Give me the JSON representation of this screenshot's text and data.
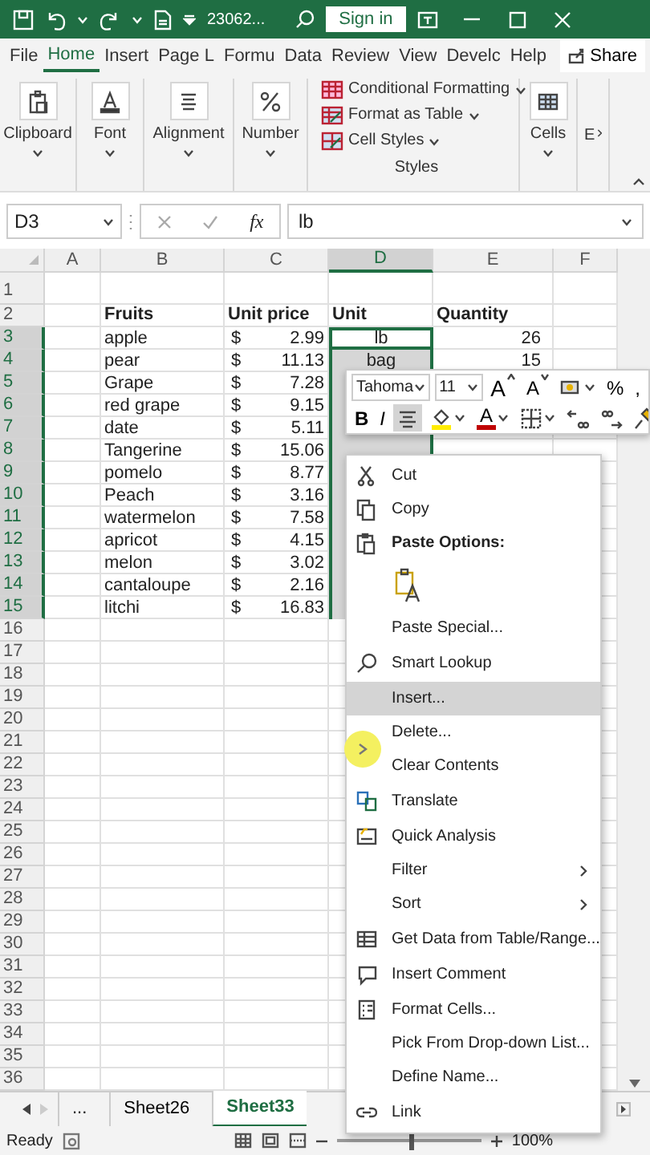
{
  "title_bar": {
    "file_name": "23062...",
    "sign_in": "Sign in"
  },
  "ribbon_tabs": [
    {
      "label": "File",
      "selected": false
    },
    {
      "label": "Home",
      "selected": true
    },
    {
      "label": "Insert",
      "selected": false
    },
    {
      "label": "Page L",
      "selected": false
    },
    {
      "label": "Formu",
      "selected": false
    },
    {
      "label": "Data",
      "selected": false
    },
    {
      "label": "Review",
      "selected": false
    },
    {
      "label": "View",
      "selected": false
    },
    {
      "label": "Develc",
      "selected": false
    },
    {
      "label": "Help",
      "selected": false
    }
  ],
  "share": "Share",
  "ribbon_groups": [
    {
      "kind": "large",
      "label": "Clipboard"
    },
    {
      "kind": "large",
      "label": "Font"
    },
    {
      "kind": "large",
      "label": "Alignment"
    },
    {
      "kind": "large",
      "label": "Number"
    },
    {
      "kind": "styles",
      "label": "Styles",
      "commands": [
        "Conditional Formatting",
        "Format as Table",
        "Cell Styles"
      ]
    },
    {
      "kind": "large",
      "label": "Cells"
    },
    {
      "kind": "cut",
      "label": "E"
    }
  ],
  "formula_bar": {
    "name_box": "D3",
    "fx": "fx",
    "content": "lb"
  },
  "sheet": {
    "columns": [
      {
        "label": "A",
        "selected": false
      },
      {
        "label": "B",
        "selected": false
      },
      {
        "label": "C",
        "selected": false
      },
      {
        "label": "D",
        "selected": true
      },
      {
        "label": "E",
        "selected": false
      },
      {
        "label": "F",
        "selected": false
      }
    ],
    "rows": [
      {
        "header": "1",
        "selected": false
      },
      {
        "header": "2",
        "selected": false,
        "cells": {
          "B": "Fruits",
          "C": "Unit price",
          "D": "Unit",
          "E": "Quantity"
        }
      },
      {
        "header": "3",
        "selected": true,
        "cells": {
          "B": "apple",
          "C": {
            "symbol": "$",
            "amount": "2.99"
          },
          "D": "lb",
          "E": "26"
        }
      },
      {
        "header": "4",
        "selected": true,
        "cells": {
          "B": "pear",
          "C": {
            "symbol": "$",
            "amount": "11.13"
          },
          "D": "bag",
          "E": "15"
        }
      },
      {
        "header": "5",
        "selected": true,
        "cells": {
          "B": "Grape",
          "C": {
            "symbol": "$",
            "amount": "7.28"
          }
        }
      },
      {
        "header": "6",
        "selected": true,
        "cells": {
          "B": "red grape",
          "C": {
            "symbol": "$",
            "amount": "9.15"
          }
        }
      },
      {
        "header": "7",
        "selected": true,
        "cells": {
          "B": "date",
          "C": {
            "symbol": "$",
            "amount": "5.11"
          }
        }
      },
      {
        "header": "8",
        "selected": true,
        "cells": {
          "B": "Tangerine",
          "C": {
            "symbol": "$",
            "amount": "15.06"
          }
        }
      },
      {
        "header": "9",
        "selected": true,
        "cells": {
          "B": "pomelo",
          "C": {
            "symbol": "$",
            "amount": "8.77"
          }
        }
      },
      {
        "header": "10",
        "selected": true,
        "cells": {
          "B": "Peach",
          "C": {
            "symbol": "$",
            "amount": "3.16"
          }
        }
      },
      {
        "header": "11",
        "selected": true,
        "cells": {
          "B": "watermelon",
          "C": {
            "symbol": "$",
            "amount": "7.58"
          }
        }
      },
      {
        "header": "12",
        "selected": true,
        "cells": {
          "B": "apricot",
          "C": {
            "symbol": "$",
            "amount": "4.15"
          }
        }
      },
      {
        "header": "13",
        "selected": true,
        "cells": {
          "B": "melon",
          "C": {
            "symbol": "$",
            "amount": "3.02"
          }
        }
      },
      {
        "header": "14",
        "selected": true,
        "cells": {
          "B": "cantaloupe",
          "C": {
            "symbol": "$",
            "amount": "2.16"
          }
        }
      },
      {
        "header": "15",
        "selected": true,
        "cells": {
          "B": "litchi",
          "C": {
            "symbol": "$",
            "amount": "16.83"
          }
        }
      },
      {
        "header": "16",
        "selected": false
      },
      {
        "header": "17",
        "selected": false
      },
      {
        "header": "18",
        "selected": false
      },
      {
        "header": "19",
        "selected": false
      },
      {
        "header": "20",
        "selected": false
      },
      {
        "header": "21",
        "selected": false
      },
      {
        "header": "22",
        "selected": false
      },
      {
        "header": "23",
        "selected": false
      },
      {
        "header": "24",
        "selected": false
      },
      {
        "header": "25",
        "selected": false
      },
      {
        "header": "26",
        "selected": false
      },
      {
        "header": "27",
        "selected": false
      },
      {
        "header": "28",
        "selected": false
      },
      {
        "header": "29",
        "selected": false
      },
      {
        "header": "30",
        "selected": false
      },
      {
        "header": "31",
        "selected": false
      },
      {
        "header": "32",
        "selected": false
      },
      {
        "header": "33",
        "selected": false
      },
      {
        "header": "34",
        "selected": false
      },
      {
        "header": "35",
        "selected": false
      },
      {
        "header": "36",
        "selected": false
      }
    ]
  },
  "sheet_tabs": {
    "overflow": "...",
    "tabs": [
      {
        "label": "Sheet26",
        "selected": false
      },
      {
        "label": "Sheet33",
        "selected": true
      }
    ]
  },
  "status_bar": {
    "status": "Ready",
    "zoom": "100%",
    "zoom_slider": {
      "level": 0.5
    }
  },
  "mini_toolbar": {
    "font": "Tahoma",
    "size": "11",
    "row1": [
      {
        "kind": "grow",
        "label": "A"
      },
      {
        "kind": "shrink",
        "label": "A"
      },
      {
        "kind": "icon"
      },
      {
        "kind": "text",
        "label": "%"
      },
      {
        "kind": "text",
        "label": ","
      }
    ],
    "row2": [
      {
        "kind": "text",
        "label": "B",
        "on": false
      },
      {
        "kind": "text",
        "label": "I",
        "on": false
      },
      {
        "kind": "icon",
        "on": true
      },
      {
        "kind": "icon"
      },
      {
        "kind": "color",
        "label": "A"
      },
      {
        "kind": "icon"
      },
      {
        "kind": "icon"
      },
      {
        "kind": "icon"
      },
      {
        "kind": "icon"
      }
    ]
  },
  "context_menu": [
    {
      "kind": "item",
      "label": "Cut",
      "highlighted": false
    },
    {
      "kind": "item",
      "label": "Copy",
      "highlighted": false
    },
    {
      "kind": "heading",
      "label": "Paste Options:"
    },
    {
      "kind": "paste-option",
      "highlighted": false
    },
    {
      "kind": "item",
      "label": "Paste Special...",
      "highlighted": false
    },
    {
      "kind": "separator"
    },
    {
      "kind": "item",
      "label": "Smart Lookup",
      "highlighted": false
    },
    {
      "kind": "separator"
    },
    {
      "kind": "item",
      "label": "Insert...",
      "highlighted": true
    },
    {
      "kind": "item",
      "label": "Delete...",
      "highlighted": false
    },
    {
      "kind": "item",
      "label": "Clear Contents",
      "highlighted": false
    },
    {
      "kind": "separator"
    },
    {
      "kind": "item",
      "label": "Translate",
      "highlighted": false
    },
    {
      "kind": "separator"
    },
    {
      "kind": "item",
      "label": "Quick Analysis",
      "highlighted": false
    },
    {
      "kind": "submenu",
      "label": "Filter",
      "highlighted": false
    },
    {
      "kind": "submenu",
      "label": "Sort",
      "highlighted": false
    },
    {
      "kind": "separator"
    },
    {
      "kind": "item",
      "label": "Get Data from Table/Range...",
      "highlighted": false
    },
    {
      "kind": "separator"
    },
    {
      "kind": "item",
      "label": "Insert Comment",
      "highlighted": false
    },
    {
      "kind": "separator"
    },
    {
      "kind": "item",
      "label": "Format Cells...",
      "highlighted": false
    },
    {
      "kind": "item",
      "label": "Pick From Drop-down List...",
      "highlighted": false
    },
    {
      "kind": "item",
      "label": "Define Name...",
      "highlighted": false
    },
    {
      "kind": "separator"
    },
    {
      "kind": "item",
      "label": "Link",
      "highlighted": false
    }
  ]
}
